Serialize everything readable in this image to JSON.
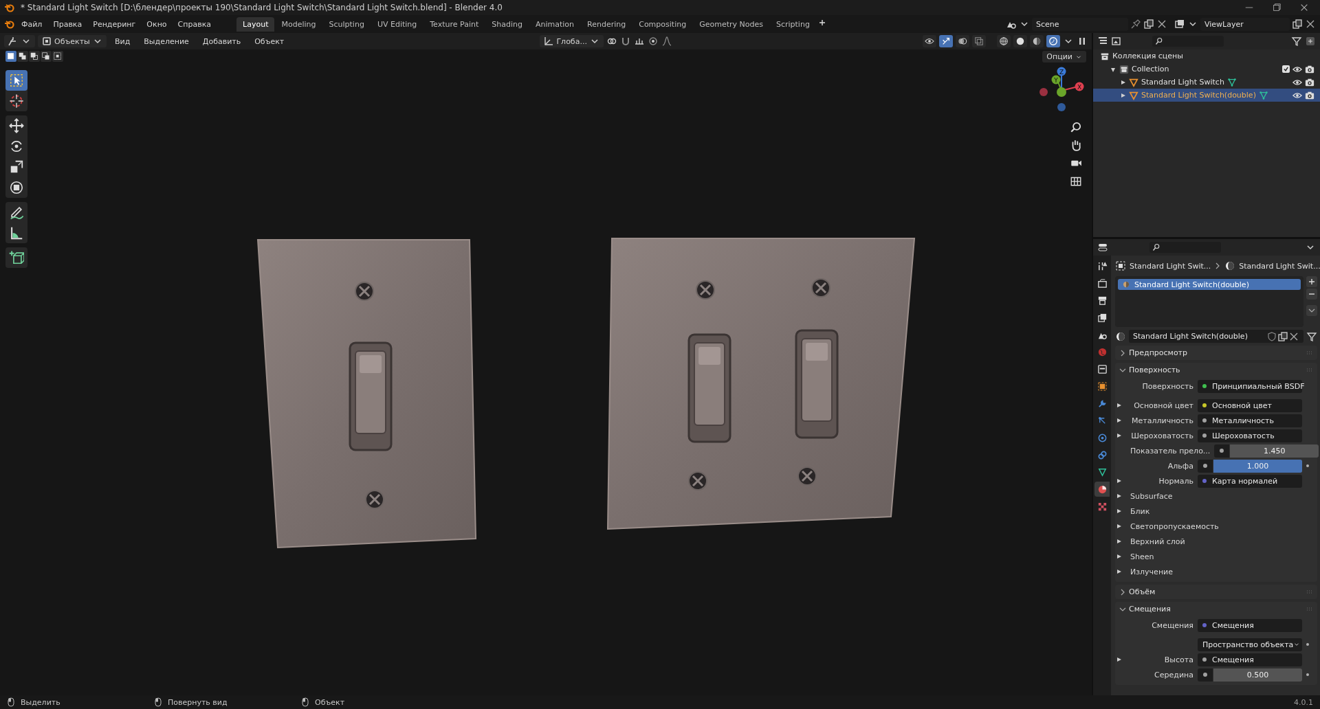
{
  "window": {
    "title": "* Standard Light Switch [D:\\блендер\\проекты 190\\Standard Light Switch\\Standard Light Switch.blend] - Blender 4.0"
  },
  "menu": [
    "Файл",
    "Правка",
    "Рендеринг",
    "Окно",
    "Справка"
  ],
  "workspaces": [
    {
      "label": "Layout",
      "selected": true
    },
    {
      "label": "Modeling",
      "selected": false
    },
    {
      "label": "Sculpting",
      "selected": false
    },
    {
      "label": "UV Editing",
      "selected": false
    },
    {
      "label": "Texture Paint",
      "selected": false
    },
    {
      "label": "Shading",
      "selected": false
    },
    {
      "label": "Animation",
      "selected": false
    },
    {
      "label": "Rendering",
      "selected": false
    },
    {
      "label": "Compositing",
      "selected": false
    },
    {
      "label": "Geometry Nodes",
      "selected": false
    },
    {
      "label": "Scripting",
      "selected": false
    }
  ],
  "scene": {
    "value": "Scene"
  },
  "view_layer": {
    "value": "ViewLayer"
  },
  "viewport": {
    "mode": "Объекты",
    "menus": [
      "Вид",
      "Выделение",
      "Добавить",
      "Объект"
    ],
    "orientation": "Глоба...",
    "options": "Опции",
    "select_modes": [
      {
        "kind": "new",
        "selected": true
      },
      {
        "kind": "extend",
        "selected": false
      },
      {
        "kind": "subtract",
        "selected": false
      },
      {
        "kind": "invert",
        "selected": false
      },
      {
        "kind": "intersect",
        "selected": false
      }
    ],
    "header_toggles": [
      {
        "kind": "visibility",
        "on": false
      },
      {
        "kind": "gizmo",
        "on": true
      },
      {
        "kind": "overlay",
        "on": false
      },
      {
        "kind": "xray",
        "on": false
      }
    ],
    "shading_modes": [
      {
        "kind": "wireframe",
        "selected": false
      },
      {
        "kind": "solid",
        "selected": false
      },
      {
        "kind": "material",
        "selected": false
      },
      {
        "kind": "rendered",
        "selected": true
      }
    ],
    "tools": [
      {
        "kind": "select-box",
        "selected": true
      },
      {
        "kind": "cursor",
        "selected": false
      },
      {
        "kind": "move",
        "selected": false
      },
      {
        "kind": "rotate",
        "selected": false
      },
      {
        "kind": "scale",
        "selected": false
      },
      {
        "kind": "transform",
        "selected": false
      },
      {
        "kind": "annotate",
        "selected": false
      },
      {
        "kind": "measure",
        "selected": false
      },
      {
        "kind": "add-cube",
        "selected": false
      }
    ],
    "gizmo_axes": [
      "X",
      "Y",
      "Z"
    ]
  },
  "outliner": {
    "tree": [
      {
        "kind": "scene-collection",
        "label": "Коллекция сцены",
        "selected": false,
        "children": [
          {
            "kind": "collection",
            "label": "Collection",
            "expanded": true,
            "checked": true,
            "selected": false,
            "children": [
              {
                "kind": "object",
                "label": "Standard Light Switch",
                "expanded": false,
                "selected": false
              },
              {
                "kind": "object",
                "label": "Standard Light Switch(double)",
                "expanded": false,
                "selected": true
              }
            ]
          }
        ]
      }
    ]
  },
  "properties": {
    "tabs": [
      {
        "kind": "tool",
        "selected": false
      },
      {
        "kind": "render",
        "selected": false
      },
      {
        "kind": "output",
        "selected": false
      },
      {
        "kind": "view-layer",
        "selected": false
      },
      {
        "kind": "scene",
        "selected": false
      },
      {
        "kind": "world",
        "selected": false
      },
      {
        "kind": "collection",
        "selected": false
      },
      {
        "kind": "object",
        "selected": false
      },
      {
        "kind": "modifier",
        "selected": false
      },
      {
        "kind": "particles",
        "selected": false
      },
      {
        "kind": "physics",
        "selected": false
      },
      {
        "kind": "constraints",
        "selected": false
      },
      {
        "kind": "data",
        "selected": false
      },
      {
        "kind": "material",
        "selected": true
      },
      {
        "kind": "texture",
        "selected": false
      }
    ],
    "breadcrumb": [
      "Standard Light Swit...",
      "Standard Light Swit..."
    ],
    "material_slots": [
      {
        "label": "Standard Light Switch(double)",
        "selected": true
      }
    ],
    "material_name": "Standard Light Switch(double)",
    "panels": [
      {
        "title": "Предпросмотр",
        "expanded": false
      },
      {
        "title": "Поверхность",
        "expanded": true,
        "rows": [
          {
            "kind": "socket",
            "label": "Поверхность",
            "value": "Принципиальный BSDF",
            "color": "#3fbf4f",
            "expandable": false
          },
          {
            "kind": "socket",
            "label": "Основной цвет",
            "value": "Основной цвет",
            "color": "#c7c729",
            "expandable": true
          },
          {
            "kind": "socket",
            "label": "Металличность",
            "value": "Металличность",
            "color": "#a1a1a1",
            "expandable": true
          },
          {
            "kind": "socket",
            "label": "Шероховатость",
            "value": "Шероховатость",
            "color": "#a1a1a1",
            "expandable": true
          },
          {
            "kind": "number",
            "label": "Показатель прело...",
            "value": "1.450"
          },
          {
            "kind": "slider",
            "label": "Альфа",
            "value": "1.000",
            "level": 1
          },
          {
            "kind": "socket",
            "label": "Нормаль",
            "value": "Карта нормалей",
            "color": "#6363c7",
            "expandable": true
          },
          {
            "kind": "subpanel",
            "label": "Subsurface"
          },
          {
            "kind": "subpanel",
            "label": "Блик"
          },
          {
            "kind": "subpanel",
            "label": "Светопропускаемость"
          },
          {
            "kind": "subpanel",
            "label": "Верхний слой"
          },
          {
            "kind": "subpanel",
            "label": "Sheen"
          },
          {
            "kind": "subpanel",
            "label": "Излучение"
          }
        ]
      },
      {
        "title": "Объём",
        "expanded": false
      },
      {
        "title": "Смещения",
        "expanded": true,
        "rows": [
          {
            "kind": "socket",
            "label": "Смещения",
            "value": "Смещения",
            "color": "#6363c7",
            "expandable": false
          },
          {
            "kind": "dropdown",
            "value": "Пространство объекта"
          },
          {
            "kind": "socket",
            "label": "Высота",
            "value": "Смещения",
            "color": "#a1a1a1",
            "expandable": true
          },
          {
            "kind": "number",
            "label": "Середина",
            "value": "0.500"
          }
        ]
      }
    ]
  },
  "status_bar": {
    "hints": [
      "Выделить",
      "Повернуть вид",
      "Объект"
    ],
    "version": "4.0.1"
  }
}
